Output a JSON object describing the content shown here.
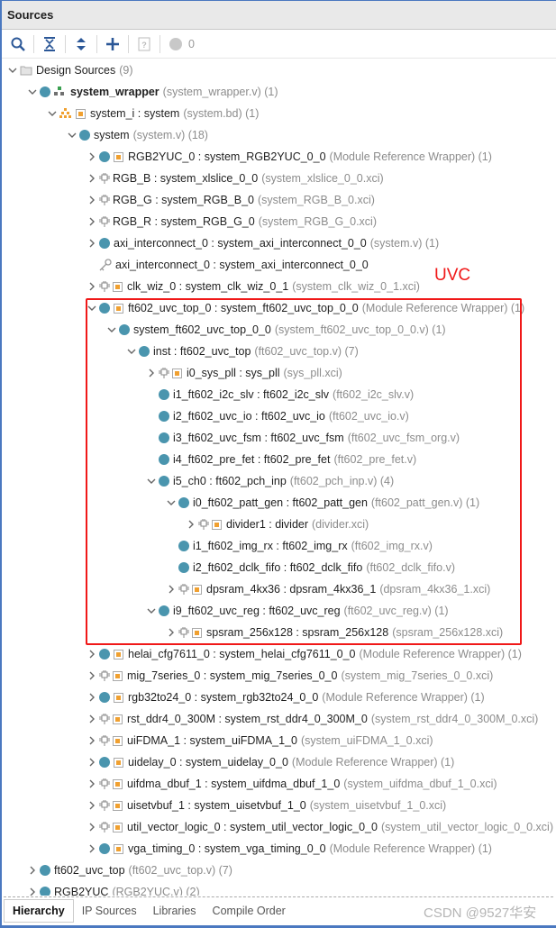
{
  "panel_title": "Sources",
  "toolbar": {
    "buttons": [
      "search-icon",
      "collapse-all-icon",
      "expand-all-icon",
      "add-icon",
      "unknown-icon"
    ],
    "warning_count": "0"
  },
  "annotation": {
    "label": "UVC",
    "color": "#f01818"
  },
  "colors": {
    "module_dot": "#4a95ae",
    "ip_square": "#f0a030",
    "accent": "#4a78c0"
  },
  "tree": [
    {
      "level": 0,
      "state": "open",
      "icons": [
        "folder"
      ],
      "name": "Design Sources",
      "suffix": "(9)"
    },
    {
      "level": 1,
      "state": "open",
      "icons": [
        "dot",
        "hier-green"
      ],
      "name": "system_wrapper",
      "bold": true,
      "suffix": "(system_wrapper.v) (1)"
    },
    {
      "level": 2,
      "state": "open",
      "icons": [
        "hier-orange",
        "square"
      ],
      "name": "system_i : system",
      "suffix": "(system.bd) (1)"
    },
    {
      "level": 3,
      "state": "open",
      "icons": [
        "dot"
      ],
      "name": "system",
      "suffix": "(system.v) (18)"
    },
    {
      "level": 4,
      "state": "closed",
      "icons": [
        "dot",
        "square"
      ],
      "name": "RGB2YUC_0 : system_RGB2YUC_0_0",
      "suffix": "(Module Reference Wrapper) (1)"
    },
    {
      "level": 4,
      "state": "closed",
      "icons": [
        "chip"
      ],
      "name": "RGB_B : system_xlslice_0_0",
      "suffix": "(system_xlslice_0_0.xci)"
    },
    {
      "level": 4,
      "state": "closed",
      "icons": [
        "chip"
      ],
      "name": "RGB_G : system_RGB_B_0",
      "suffix": "(system_RGB_B_0.xci)"
    },
    {
      "level": 4,
      "state": "closed",
      "icons": [
        "chip"
      ],
      "name": "RGB_R : system_RGB_G_0",
      "suffix": "(system_RGB_G_0.xci)"
    },
    {
      "level": 4,
      "state": "closed",
      "icons": [
        "dot"
      ],
      "name": "axi_interconnect_0 : system_axi_interconnect_0_0",
      "suffix": "(system.v) (1)"
    },
    {
      "level": 4,
      "state": "none",
      "icons": [
        "key"
      ],
      "name": "axi_interconnect_0 : system_axi_interconnect_0_0",
      "suffix": ""
    },
    {
      "level": 4,
      "state": "closed",
      "icons": [
        "chip",
        "square"
      ],
      "name": "clk_wiz_0 : system_clk_wiz_0_1",
      "suffix": "(system_clk_wiz_0_1.xci)"
    },
    {
      "level": 4,
      "state": "open",
      "icons": [
        "dot",
        "square"
      ],
      "name": "ft602_uvc_top_0 : system_ft602_uvc_top_0_0",
      "suffix": "(Module Reference Wrapper) (1)"
    },
    {
      "level": 5,
      "state": "open",
      "icons": [
        "dot"
      ],
      "name": "system_ft602_uvc_top_0_0",
      "suffix": "(system_ft602_uvc_top_0_0.v) (1)"
    },
    {
      "level": 6,
      "state": "open",
      "icons": [
        "dot"
      ],
      "name": "inst : ft602_uvc_top",
      "suffix": "(ft602_uvc_top.v) (7)"
    },
    {
      "level": 7,
      "state": "closed",
      "icons": [
        "chip",
        "square"
      ],
      "name": "i0_sys_pll : sys_pll",
      "suffix": "(sys_pll.xci)"
    },
    {
      "level": 7,
      "state": "none",
      "icons": [
        "dot"
      ],
      "name": "i1_ft602_i2c_slv : ft602_i2c_slv",
      "suffix": "(ft602_i2c_slv.v)"
    },
    {
      "level": 7,
      "state": "none",
      "icons": [
        "dot"
      ],
      "name": "i2_ft602_uvc_io : ft602_uvc_io",
      "suffix": "(ft602_uvc_io.v)"
    },
    {
      "level": 7,
      "state": "none",
      "icons": [
        "dot"
      ],
      "name": "i3_ft602_uvc_fsm : ft602_uvc_fsm",
      "suffix": "(ft602_uvc_fsm_org.v)"
    },
    {
      "level": 7,
      "state": "none",
      "icons": [
        "dot"
      ],
      "name": "i4_ft602_pre_fet : ft602_pre_fet",
      "suffix": "(ft602_pre_fet.v)"
    },
    {
      "level": 7,
      "state": "open",
      "icons": [
        "dot"
      ],
      "name": "i5_ch0 : ft602_pch_inp",
      "suffix": "(ft602_pch_inp.v) (4)"
    },
    {
      "level": 8,
      "state": "open",
      "icons": [
        "dot"
      ],
      "name": "i0_ft602_patt_gen : ft602_patt_gen",
      "suffix": "(ft602_patt_gen.v) (1)"
    },
    {
      "level": 9,
      "state": "closed",
      "icons": [
        "chip",
        "square"
      ],
      "name": "divider1 : divider",
      "suffix": "(divider.xci)"
    },
    {
      "level": 8,
      "state": "none",
      "icons": [
        "dot"
      ],
      "name": "i1_ft602_img_rx : ft602_img_rx",
      "suffix": "(ft602_img_rx.v)"
    },
    {
      "level": 8,
      "state": "none",
      "icons": [
        "dot"
      ],
      "name": "i2_ft602_dclk_fifo : ft602_dclk_fifo",
      "suffix": "(ft602_dclk_fifo.v)"
    },
    {
      "level": 8,
      "state": "closed",
      "icons": [
        "chip",
        "square"
      ],
      "name": "dpsram_4kx36 : dpsram_4kx36_1",
      "suffix": "(dpsram_4kx36_1.xci)"
    },
    {
      "level": 7,
      "state": "open",
      "icons": [
        "dot"
      ],
      "name": "i9_ft602_uvc_reg : ft602_uvc_reg",
      "suffix": "(ft602_uvc_reg.v) (1)"
    },
    {
      "level": 8,
      "state": "closed",
      "icons": [
        "chip",
        "square"
      ],
      "name": "spsram_256x128 : spsram_256x128",
      "suffix": "(spsram_256x128.xci)"
    },
    {
      "level": 4,
      "state": "closed",
      "icons": [
        "dot",
        "square"
      ],
      "name": "helai_cfg7611_0 : system_helai_cfg7611_0_0",
      "suffix": "(Module Reference Wrapper) (1)"
    },
    {
      "level": 4,
      "state": "closed",
      "icons": [
        "chip",
        "square"
      ],
      "name": "mig_7series_0 : system_mig_7series_0_0",
      "suffix": "(system_mig_7series_0_0.xci)"
    },
    {
      "level": 4,
      "state": "closed",
      "icons": [
        "dot",
        "square"
      ],
      "name": "rgb32to24_0 : system_rgb32to24_0_0",
      "suffix": "(Module Reference Wrapper) (1)"
    },
    {
      "level": 4,
      "state": "closed",
      "icons": [
        "chip",
        "square"
      ],
      "name": "rst_ddr4_0_300M : system_rst_ddr4_0_300M_0",
      "suffix": "(system_rst_ddr4_0_300M_0.xci)"
    },
    {
      "level": 4,
      "state": "closed",
      "icons": [
        "chip",
        "square"
      ],
      "name": "uiFDMA_1 : system_uiFDMA_1_0",
      "suffix": "(system_uiFDMA_1_0.xci)"
    },
    {
      "level": 4,
      "state": "closed",
      "icons": [
        "dot",
        "square"
      ],
      "name": "uidelay_0 : system_uidelay_0_0",
      "suffix": "(Module Reference Wrapper) (1)"
    },
    {
      "level": 4,
      "state": "closed",
      "icons": [
        "chip",
        "square"
      ],
      "name": "uifdma_dbuf_1 : system_uifdma_dbuf_1_0",
      "suffix": "(system_uifdma_dbuf_1_0.xci)"
    },
    {
      "level": 4,
      "state": "closed",
      "icons": [
        "chip",
        "square"
      ],
      "name": "uisetvbuf_1 : system_uisetvbuf_1_0",
      "suffix": "(system_uisetvbuf_1_0.xci)"
    },
    {
      "level": 4,
      "state": "closed",
      "icons": [
        "chip",
        "square"
      ],
      "name": "util_vector_logic_0 : system_util_vector_logic_0_0",
      "suffix": "(system_util_vector_logic_0_0.xci)"
    },
    {
      "level": 4,
      "state": "closed",
      "icons": [
        "dot",
        "square"
      ],
      "name": "vga_timing_0 : system_vga_timing_0_0",
      "suffix": "(Module Reference Wrapper) (1)"
    },
    {
      "level": 1,
      "state": "closed",
      "icons": [
        "dot"
      ],
      "name": "ft602_uvc_top",
      "suffix": "(ft602_uvc_top.v) (7)"
    },
    {
      "level": 1,
      "state": "closed",
      "icons": [
        "dot"
      ],
      "name": "RGB2YUC",
      "suffix": "(RGB2YUC.v) (2)"
    }
  ],
  "tabs": [
    {
      "label": "Hierarchy",
      "active": true
    },
    {
      "label": "IP Sources"
    },
    {
      "label": "Libraries"
    },
    {
      "label": "Compile Order"
    }
  ],
  "watermark": "CSDN @9527华安"
}
